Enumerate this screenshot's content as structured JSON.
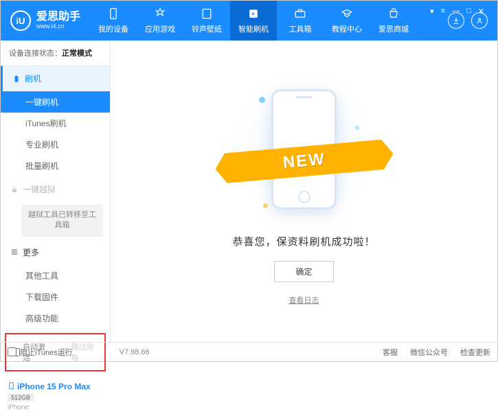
{
  "logo": {
    "mark": "iU",
    "name": "爱思助手",
    "url": "www.i4.cn"
  },
  "nav": {
    "items": [
      {
        "label": "我的设备"
      },
      {
        "label": "应用游戏"
      },
      {
        "label": "铃声壁纸"
      },
      {
        "label": "智能刷机"
      },
      {
        "label": "工具箱"
      },
      {
        "label": "教程中心"
      },
      {
        "label": "爱思商城"
      }
    ]
  },
  "status": {
    "prefix": "设备连接状态：",
    "value": "正常模式"
  },
  "sidebar": {
    "flash": {
      "head": "刷机",
      "items": [
        "一键刷机",
        "iTunes刷机",
        "专业刷机",
        "批量刷机"
      ]
    },
    "jailbreak": {
      "head": "一键越狱",
      "note": "越狱工具已转移至工具箱"
    },
    "more": {
      "head": "更多",
      "items": [
        "其他工具",
        "下载固件",
        "高级功能"
      ]
    },
    "checks": {
      "auto": "自动激活",
      "skip": "跳过向导"
    },
    "device": {
      "name": "iPhone 15 Pro Max",
      "storage": "512GB",
      "type": "iPhone"
    }
  },
  "main": {
    "ribbon": "NEW",
    "success": "恭喜您，保资料刷机成功啦！",
    "ok": "确定",
    "log": "查看日志"
  },
  "footer": {
    "block": "阻止iTunes运行",
    "version": "V7.98.66",
    "links": [
      "客服",
      "微信公众号",
      "检查更新"
    ]
  }
}
